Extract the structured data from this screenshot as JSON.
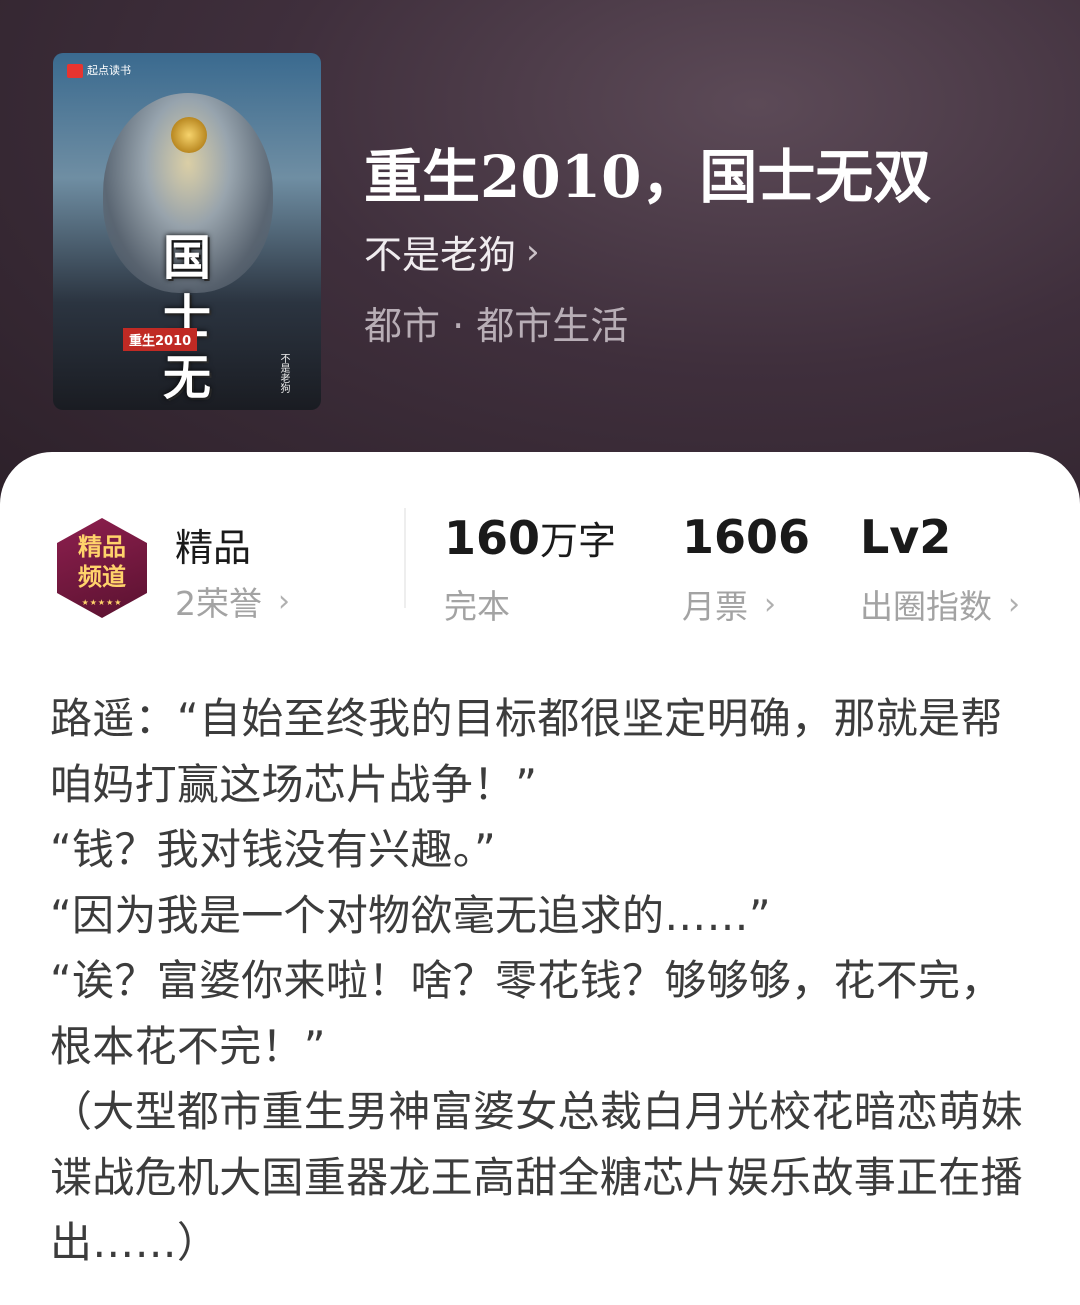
{
  "book": {
    "title": "重生2010，国士无双",
    "author": "不是老狗",
    "genre": "都市 · 都市生活"
  },
  "cover": {
    "publisher_badge": "起点读书",
    "title_text": "国士无双",
    "subtitle_text": "重生2010",
    "author_text": "不是老狗"
  },
  "stats": {
    "channel": {
      "label": "精品",
      "sub": "2荣誉",
      "medal_text": "精品频道",
      "medal_stars": "★★★★★"
    },
    "word_count": {
      "value": "160",
      "unit": "万字",
      "sub": "完本"
    },
    "monthly_votes": {
      "value": "1606",
      "sub": "月票"
    },
    "influence": {
      "value": "Lv2",
      "sub": "出圈指数"
    }
  },
  "description": [
    "路遥：“自始至终我的目标都很坚定明确，那就是帮咱妈打赢这场芯片战争！”",
    "“钱？我对钱没有兴趣。”",
    "“因为我是一个对物欲毫无追求的……”",
    "“诶？富婆你来啦！啥？零花钱？够够够，花不完，根本花不完！”",
    "（大型都市重生男神富婆女总裁白月光校花暗恋萌妹谍战危机大国重器龙王高甜全糖芯片娱乐故事正在播出……）"
  ],
  "colors": {
    "header_bg": "#3f2f3c",
    "text_primary": "#1a1a1a",
    "text_secondary": "#a3a3a3",
    "medal_bg": "#8d1f4e",
    "medal_gold": "#ffd36b"
  }
}
